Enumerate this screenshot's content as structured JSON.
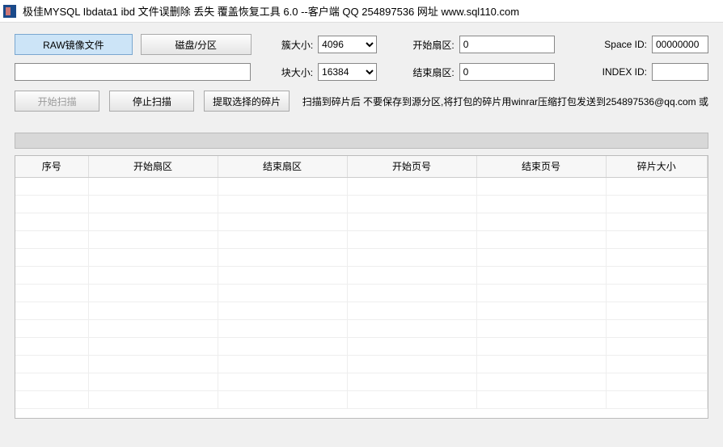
{
  "titlebar": {
    "text": "极佳MYSQL Ibdata1 ibd 文件误删除 丢失 覆盖恢复工具 6.0 --客户端 QQ 254897536 网址 www.sql110.com"
  },
  "buttons": {
    "raw": "RAW镜像文件",
    "disk": "磁盘/分区",
    "start_scan": "开始扫描",
    "stop_scan": "停止扫描",
    "extract": "提取选择的碎片"
  },
  "labels": {
    "cluster_size": "簇大小:",
    "block_size": "块大小:",
    "start_sector": "开始扇区:",
    "end_sector": "结束扇区:",
    "space_id": "Space ID:",
    "index_id": "INDEX ID:"
  },
  "values": {
    "cluster_size": "4096",
    "block_size": "16384",
    "start_sector": "0",
    "end_sector": "0",
    "space_id": "00000000",
    "index_id": "",
    "path": ""
  },
  "note": "扫描到碎片后 不要保存到源分区,将打包的碎片用winrar压缩打包发送到254897536@qq.com 或",
  "table": {
    "headers": {
      "seq": "序号",
      "start_sector": "开始扇区",
      "end_sector": "结束扇区",
      "start_page": "开始页号",
      "end_page": "结束页号",
      "frag_size": "碎片大小"
    },
    "rows": [
      {},
      {},
      {},
      {},
      {},
      {},
      {},
      {},
      {},
      {},
      {},
      {},
      {}
    ]
  }
}
